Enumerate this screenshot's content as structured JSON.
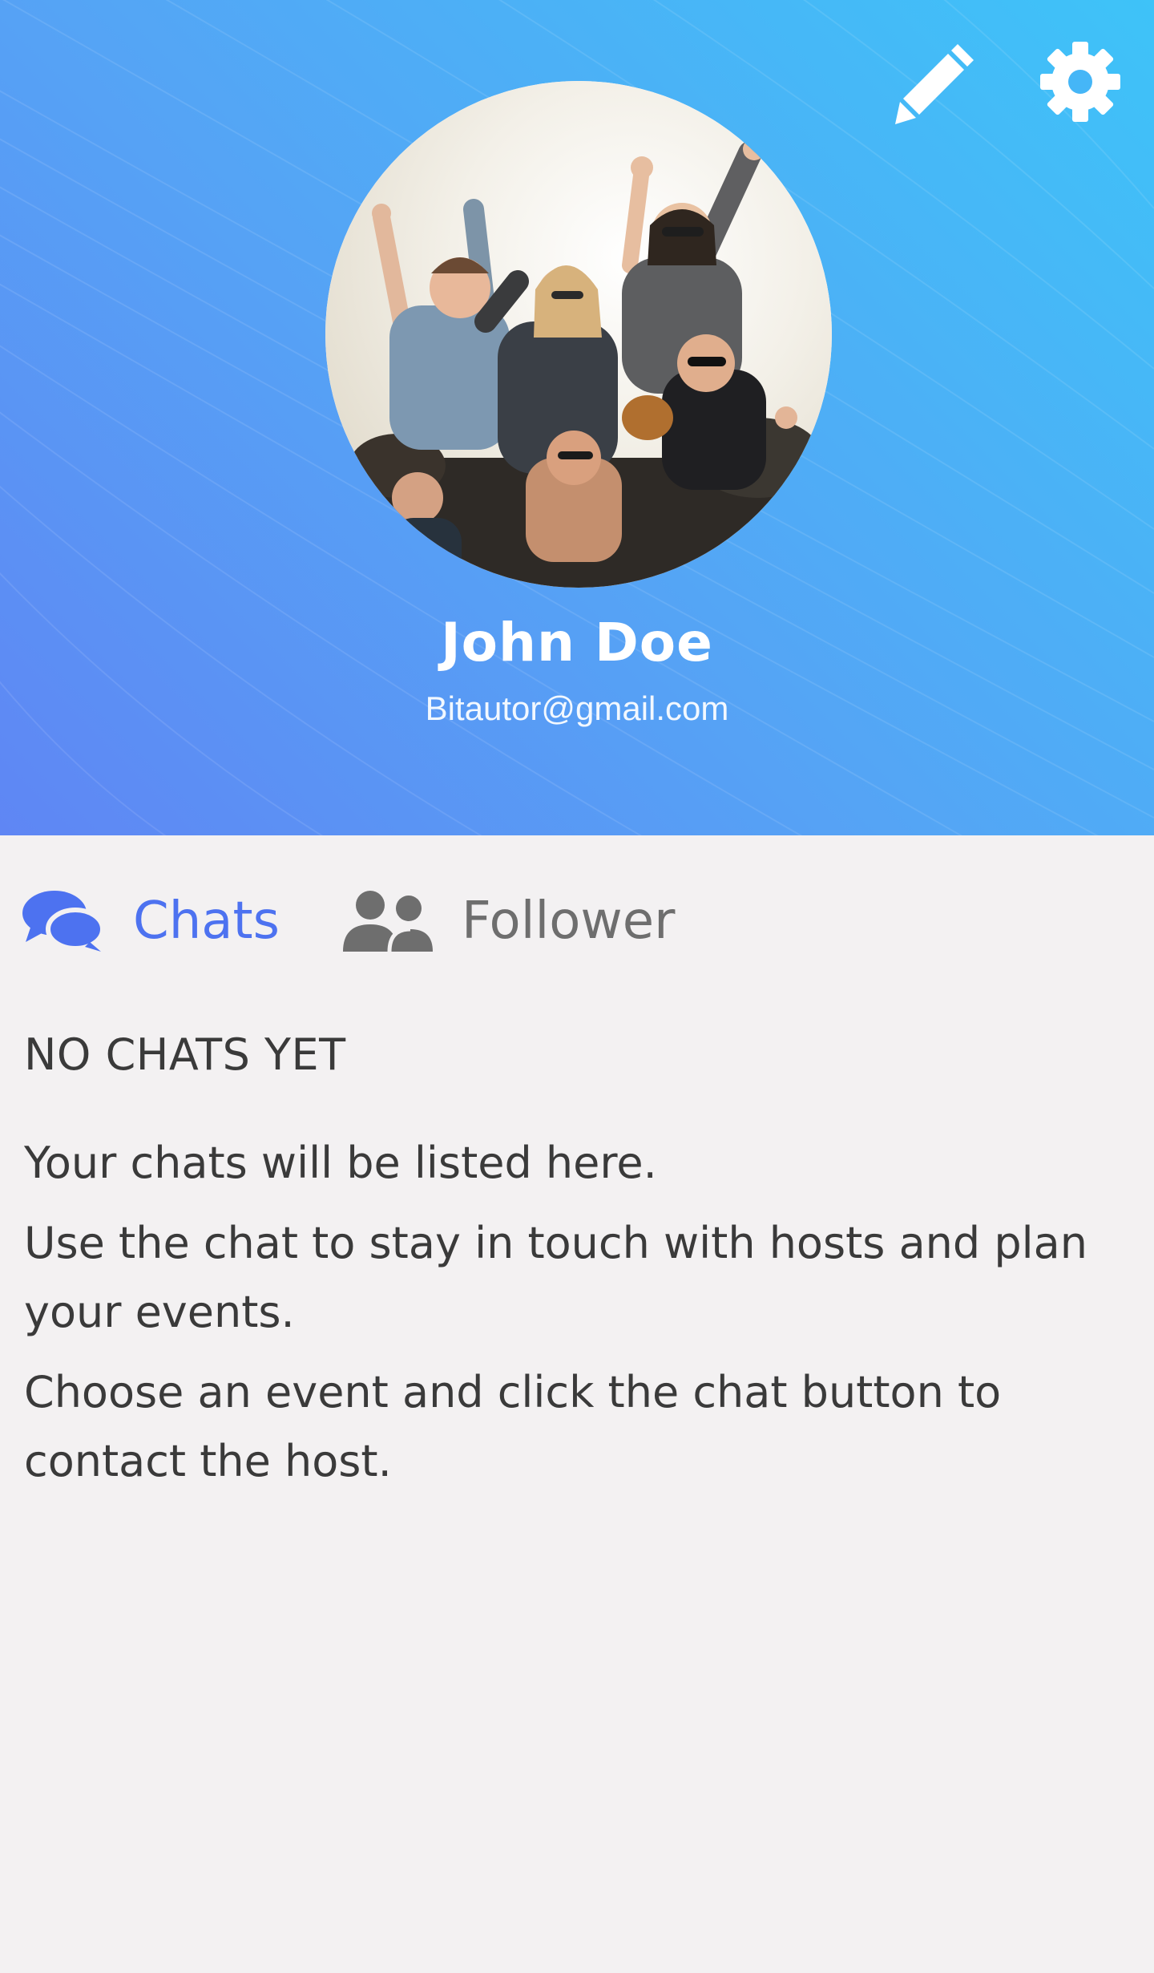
{
  "header": {
    "gradient_colors": [
      "#5f86f4",
      "#55a4f5",
      "#3ec3f8"
    ],
    "edit_icon": "pencil-icon",
    "settings_icon": "gear-icon"
  },
  "profile": {
    "name": "John Doe",
    "email": "Bitautor@gmail.com"
  },
  "tabs": [
    {
      "label": "Chats",
      "icon": "chat-bubbles-icon",
      "active": true,
      "color": "#4d72f0"
    },
    {
      "label": "Follower",
      "icon": "users-icon",
      "active": false,
      "color": "#6e6e6e"
    }
  ],
  "chats_empty": {
    "title": "NO CHATS YET",
    "lines": [
      "Your chats will be listed here.",
      "Use the chat to stay in touch with hosts and plan your events.",
      "Choose an event and click the chat button to contact the host."
    ]
  }
}
